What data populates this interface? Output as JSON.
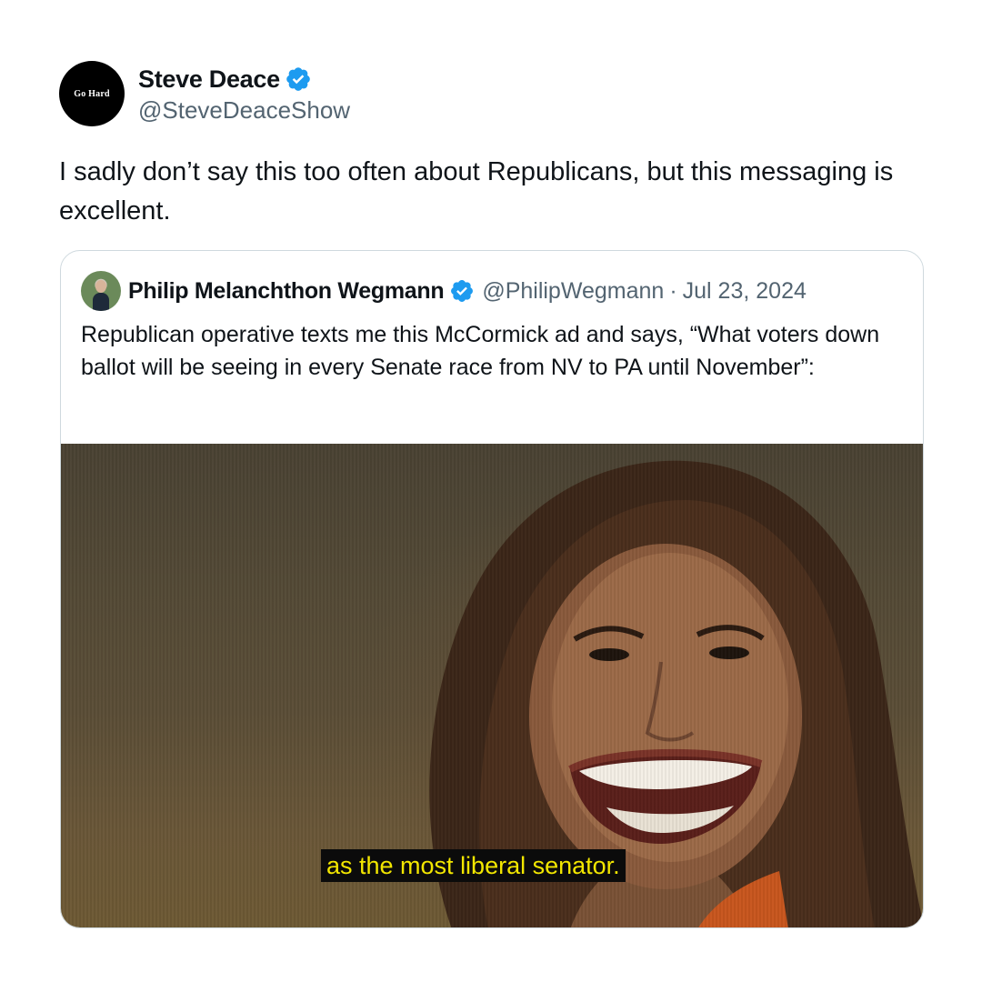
{
  "author": {
    "avatar_text": "Go Hard",
    "name": "Steve Deace",
    "handle": "@SteveDeaceShow",
    "verified": true
  },
  "tweet": {
    "text": "I sadly don’t say this too often about Republicans, but this messaging is excellent."
  },
  "quoted_tweet": {
    "name": "Philip Melanchthon Wegmann",
    "handle": "@PhilipWegmann",
    "separator": "·",
    "date": "Jul 23, 2024",
    "verified": true,
    "text": "Republican operative texts me this McCormick ad and says, “What voters down ballot will be seeing in every Senate race from NV to PA until November”:",
    "media": {
      "caption": "as the most liberal senator."
    }
  },
  "colors": {
    "verified_blue": "#1d9bf0",
    "secondary_text": "#536471",
    "border": "#cfd9de",
    "caption_text": "#f2e600"
  }
}
